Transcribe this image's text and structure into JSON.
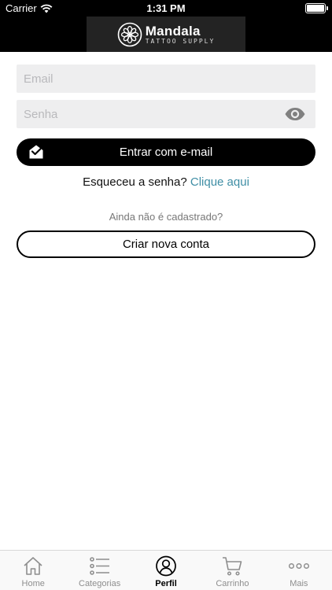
{
  "status_bar": {
    "carrier": "Carrier",
    "time": "1:31 PM"
  },
  "brand": {
    "name": "Mandala",
    "subtitle": "TATTOO SUPPLY"
  },
  "form": {
    "email_placeholder": "Email",
    "password_placeholder": "Senha",
    "login_label": "Entrar com e-mail",
    "forgot_prefix": "Esqueceu a senha?",
    "forgot_link": "Clique aqui",
    "not_registered": "Ainda não é cadastrado?",
    "create_account_label": "Criar nova conta"
  },
  "tabbar": {
    "tabs": [
      {
        "label": "Home",
        "icon": "home-icon",
        "active": false
      },
      {
        "label": "Categorias",
        "icon": "list-icon",
        "active": false
      },
      {
        "label": "Perfil",
        "icon": "user-icon",
        "active": true
      },
      {
        "label": "Carrinho",
        "icon": "cart-icon",
        "active": false
      },
      {
        "label": "Mais",
        "icon": "more-icon",
        "active": false
      }
    ]
  },
  "colors": {
    "link": "#3f8ea5",
    "primary": "#000000",
    "field_bg": "#eeeeef"
  }
}
